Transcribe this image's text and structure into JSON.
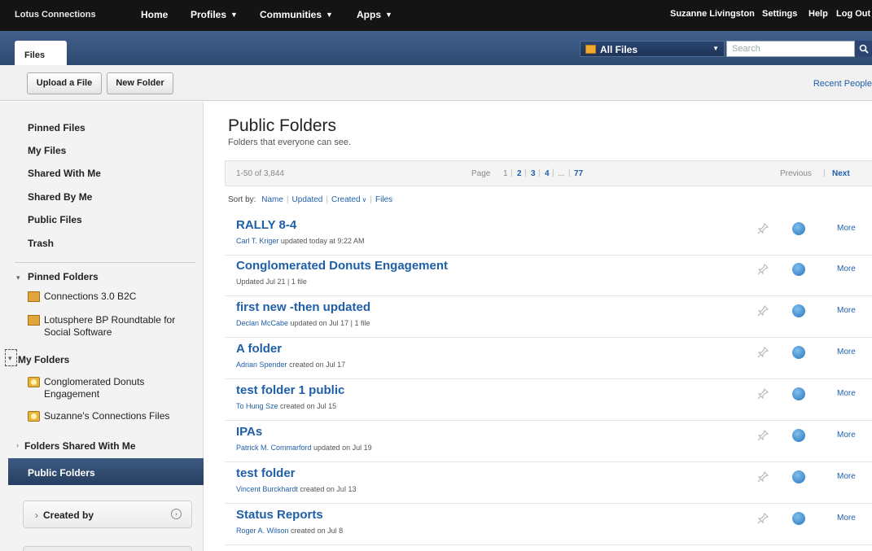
{
  "topnav": {
    "brand": "Lotus Connections",
    "home": "Home",
    "profiles": "Profiles",
    "communities": "Communities",
    "apps": "Apps",
    "user": "Suzanne Livingston",
    "settings": "Settings",
    "help": "Help",
    "logout": "Log Out"
  },
  "filesbar": {
    "tab": "Files",
    "scope": "All Files",
    "search_placeholder": "Search"
  },
  "actions": {
    "upload": "Upload a File",
    "new_folder": "New Folder",
    "recent": "Recent People"
  },
  "sidebar": {
    "items": [
      "Pinned Files",
      "My Files",
      "Shared With Me",
      "Shared By Me",
      "Public Files",
      "Trash"
    ],
    "pinned_folders_label": "Pinned Folders",
    "pinned_folders": [
      "Connections 3.0 B2C",
      "Lotusphere BP Roundtable for Social Software"
    ],
    "my_folders_label": "My Folders",
    "my_folders": [
      "Conglomerated Donuts Engagement",
      "Suzanne's Connections Files"
    ],
    "shared_folders_label": "Folders Shared With Me",
    "public_folders_label": "Public Folders",
    "created_by": "Created by"
  },
  "main": {
    "title": "Public Folders",
    "subtitle": "Folders that everyone can see.",
    "pager": {
      "range": "1-50 of 3,844",
      "label": "Page",
      "pages": [
        "1",
        "2",
        "3",
        "4",
        "...",
        "77"
      ],
      "previous": "Previous",
      "next": "Next"
    },
    "sort": {
      "label": "Sort by:",
      "options": [
        "Name",
        "Updated",
        "Created",
        "Files"
      ]
    },
    "more_label": "More",
    "folders": [
      {
        "title": "RALLY 8-4",
        "person": "Carl T. Kriger",
        "meta": "updated today at 9:22 AM"
      },
      {
        "title": "Conglomerated Donuts Engagement",
        "person": "",
        "meta": "Updated Jul 21 | 1 file"
      },
      {
        "title": "first new -then updated",
        "person": "Declan McCabe",
        "meta": "updated on Jul 17 | 1 file"
      },
      {
        "title": "A folder",
        "person": "Adrian Spender",
        "meta": "created on Jul 17"
      },
      {
        "title": "test folder 1 public",
        "person": "To Hung Sze",
        "meta": "created on Jul 15"
      },
      {
        "title": "IPAs",
        "person": "Patrick M. Commarford",
        "meta": "updated on Jul 19"
      },
      {
        "title": "test folder",
        "person": "Vincent Burckhardt",
        "meta": "created on Jul 13"
      },
      {
        "title": "Status Reports",
        "person": "Roger A. Wilson",
        "meta": "created on Jul 8"
      }
    ]
  }
}
